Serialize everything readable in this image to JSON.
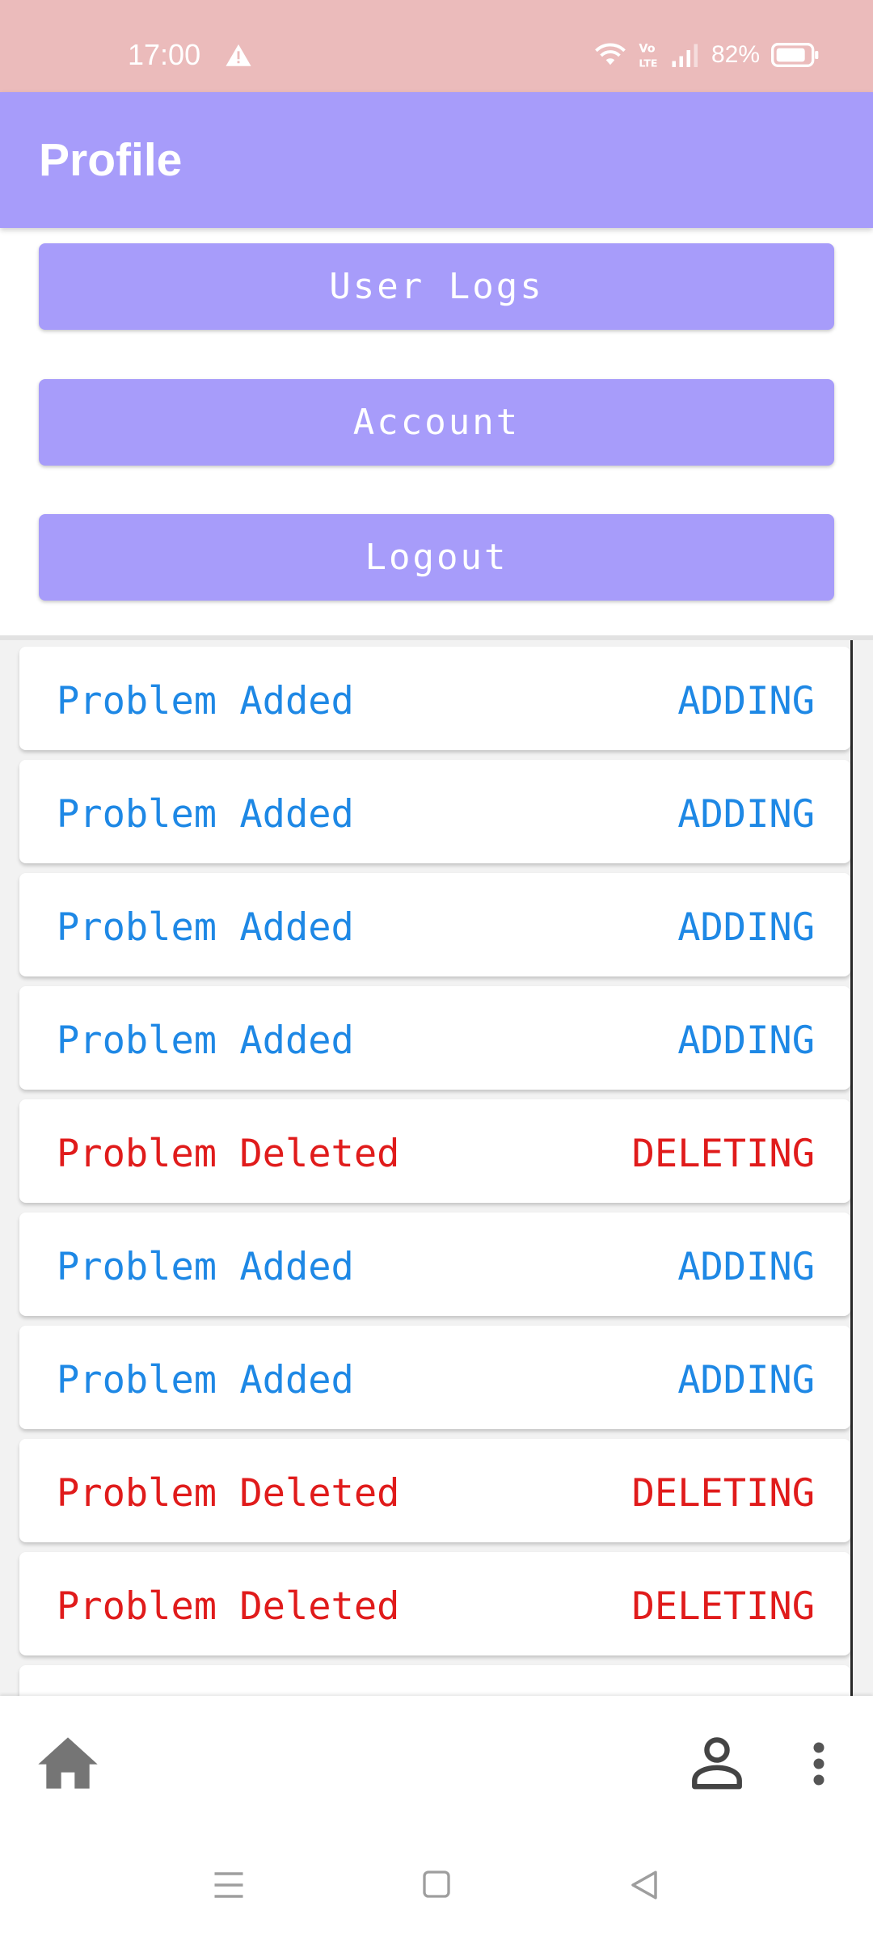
{
  "status_bar": {
    "time": "17:00",
    "network_badge": "Vo LTE",
    "battery": "82%",
    "icons": [
      "warning-icon",
      "wifi-icon",
      "volte-icon",
      "signal-icon",
      "battery-icon"
    ]
  },
  "app_bar": {
    "title": "Profile"
  },
  "menu": {
    "user_logs_label": "User Logs",
    "account_label": "Account",
    "logout_label": "Logout"
  },
  "logs": [
    {
      "message": "Problem Added",
      "type": "ADDING"
    },
    {
      "message": "Problem Added",
      "type": "ADDING"
    },
    {
      "message": "Problem Added",
      "type": "ADDING"
    },
    {
      "message": "Problem Added",
      "type": "ADDING"
    },
    {
      "message": "Problem Deleted",
      "type": "DELETING"
    },
    {
      "message": "Problem Added",
      "type": "ADDING"
    },
    {
      "message": "Problem Added",
      "type": "ADDING"
    },
    {
      "message": "Problem Deleted",
      "type": "DELETING"
    },
    {
      "message": "Problem Deleted",
      "type": "DELETING"
    }
  ],
  "bottom_nav": {
    "icons": [
      "home-icon",
      "person-icon",
      "more-vert-icon"
    ]
  },
  "system_nav": {
    "icons": [
      "recents-icon",
      "home-square-icon",
      "back-icon"
    ]
  },
  "colors": {
    "status_bar": "#ebbbbb",
    "accent": "#a79cfa",
    "adding": "#1e88e5",
    "deleting": "#e01b1b",
    "nav_icon": "#757575"
  }
}
